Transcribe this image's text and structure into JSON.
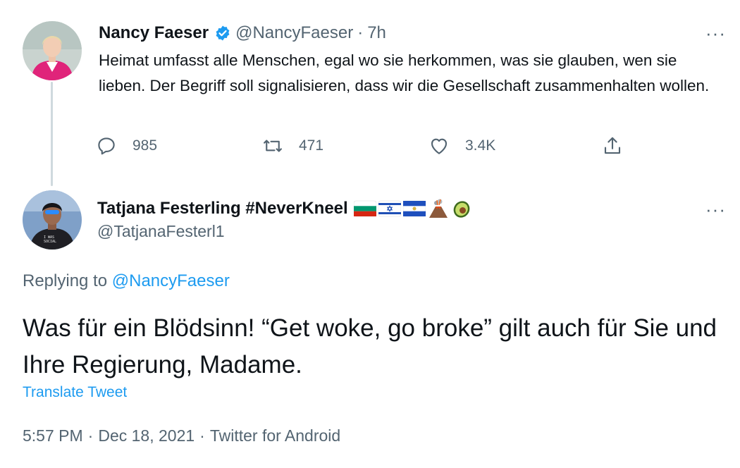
{
  "tweet1": {
    "name": "Nancy Faeser",
    "verified_icon": "verified-badge-icon",
    "handle": "@NancyFaeser",
    "separator": "·",
    "time": "7h",
    "more_label": "···",
    "text": "Heimat umfasst alle Menschen, egal wo sie herkommen, was sie glauben, wen sie lieben. Der Begriff soll signalisieren, dass wir die Gesellschaft zusammenhalten wollen.",
    "actions": {
      "replies": "985",
      "retweets": "471",
      "likes": "3.4K"
    }
  },
  "tweet2": {
    "name": "Tatjana Festerling #NeverKneel",
    "name_emojis": [
      "bulgaria-flag",
      "israel-flag",
      "el-salvador-flag",
      "volcano",
      "avocado"
    ],
    "handle": "@TatjanaFesterl1",
    "more_label": "···",
    "replying_prefix": "Replying to",
    "replying_to": "@NancyFaeser",
    "text": "Was für ein Blödsinn! “Get woke, go broke” gilt auch für Sie und Ihre Regierung, Madame.",
    "translate_label": "Translate Tweet",
    "meta": {
      "time": "5:57 PM",
      "date": "Dec 18, 2021",
      "source": "Twitter for Android",
      "separator": "·"
    }
  },
  "colors": {
    "accent": "#1d9bf0",
    "text": "#0f1419",
    "secondary": "#536471",
    "thread_line": "#cfd9de"
  }
}
